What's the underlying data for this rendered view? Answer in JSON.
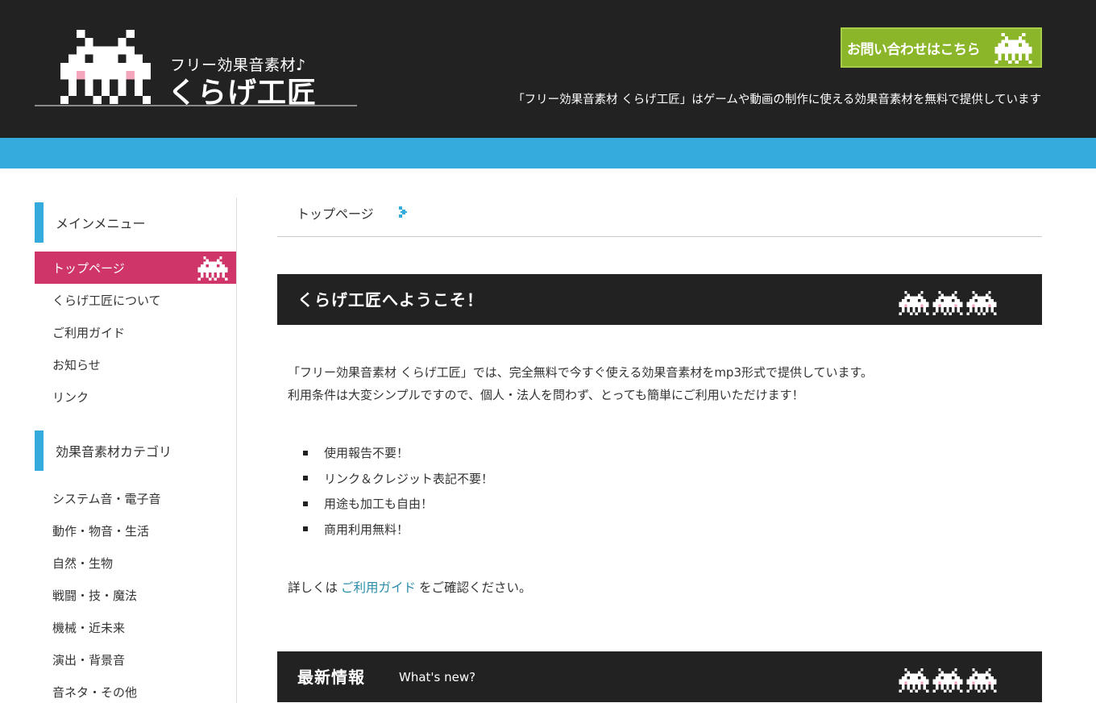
{
  "header": {
    "logo_sub": "フリー効果音素材♪",
    "logo_title": "くらげ工匠",
    "contact_label": "お問い合わせはこちら",
    "tagline": "「フリー効果音素材 くらげ工匠」はゲームや動画の制作に使える効果音素材を無料で提供しています"
  },
  "sidebar": {
    "main_heading": "メインメニュー",
    "main_items": [
      {
        "label": "トップページ",
        "active": true
      },
      {
        "label": "くらげ工匠について"
      },
      {
        "label": "ご利用ガイド"
      },
      {
        "label": "お知らせ"
      },
      {
        "label": "リンク"
      }
    ],
    "category_heading": "効果音素材カテゴリ",
    "category_items": [
      {
        "label": "システム音・電子音"
      },
      {
        "label": "動作・物音・生活"
      },
      {
        "label": "自然・生物"
      },
      {
        "label": "戦闘・技・魔法"
      },
      {
        "label": "機械・近未来"
      },
      {
        "label": "演出・背景音"
      },
      {
        "label": "音ネタ・その他"
      }
    ]
  },
  "breadcrumb": {
    "current": "トップページ"
  },
  "welcome": {
    "title": "くらげ工匠へようこそ！",
    "intro_line1": "「フリー効果音素材 くらげ工匠」では、完全無料で今すぐ使える効果音素材をmp3形式で提供しています。",
    "intro_line2": "利用条件は大変シンプルですので、個人・法人を問わず、とっても簡単にご利用いただけます！",
    "bullets": [
      "使用報告不要！",
      "リンク＆クレジット表記不要！",
      "用途も加工も自由！",
      "商用利用無料！"
    ],
    "guide_prefix": "詳しくは",
    "guide_link": "ご利用ガイド",
    "guide_suffix": "をご確認ください。"
  },
  "news": {
    "title": "最新情報",
    "subtitle": "What's new?"
  },
  "colors": {
    "header_bg": "#222222",
    "accent_blue": "#35aadc",
    "active_pink": "#cf3569",
    "contact_green": "#8bb62a",
    "link": "#2a8ca8"
  },
  "icons": {
    "logo": "space-invader-logo-icon",
    "contact": "space-invader-icon",
    "breadcrumb_arrow": "pixel-arrow-icon"
  }
}
